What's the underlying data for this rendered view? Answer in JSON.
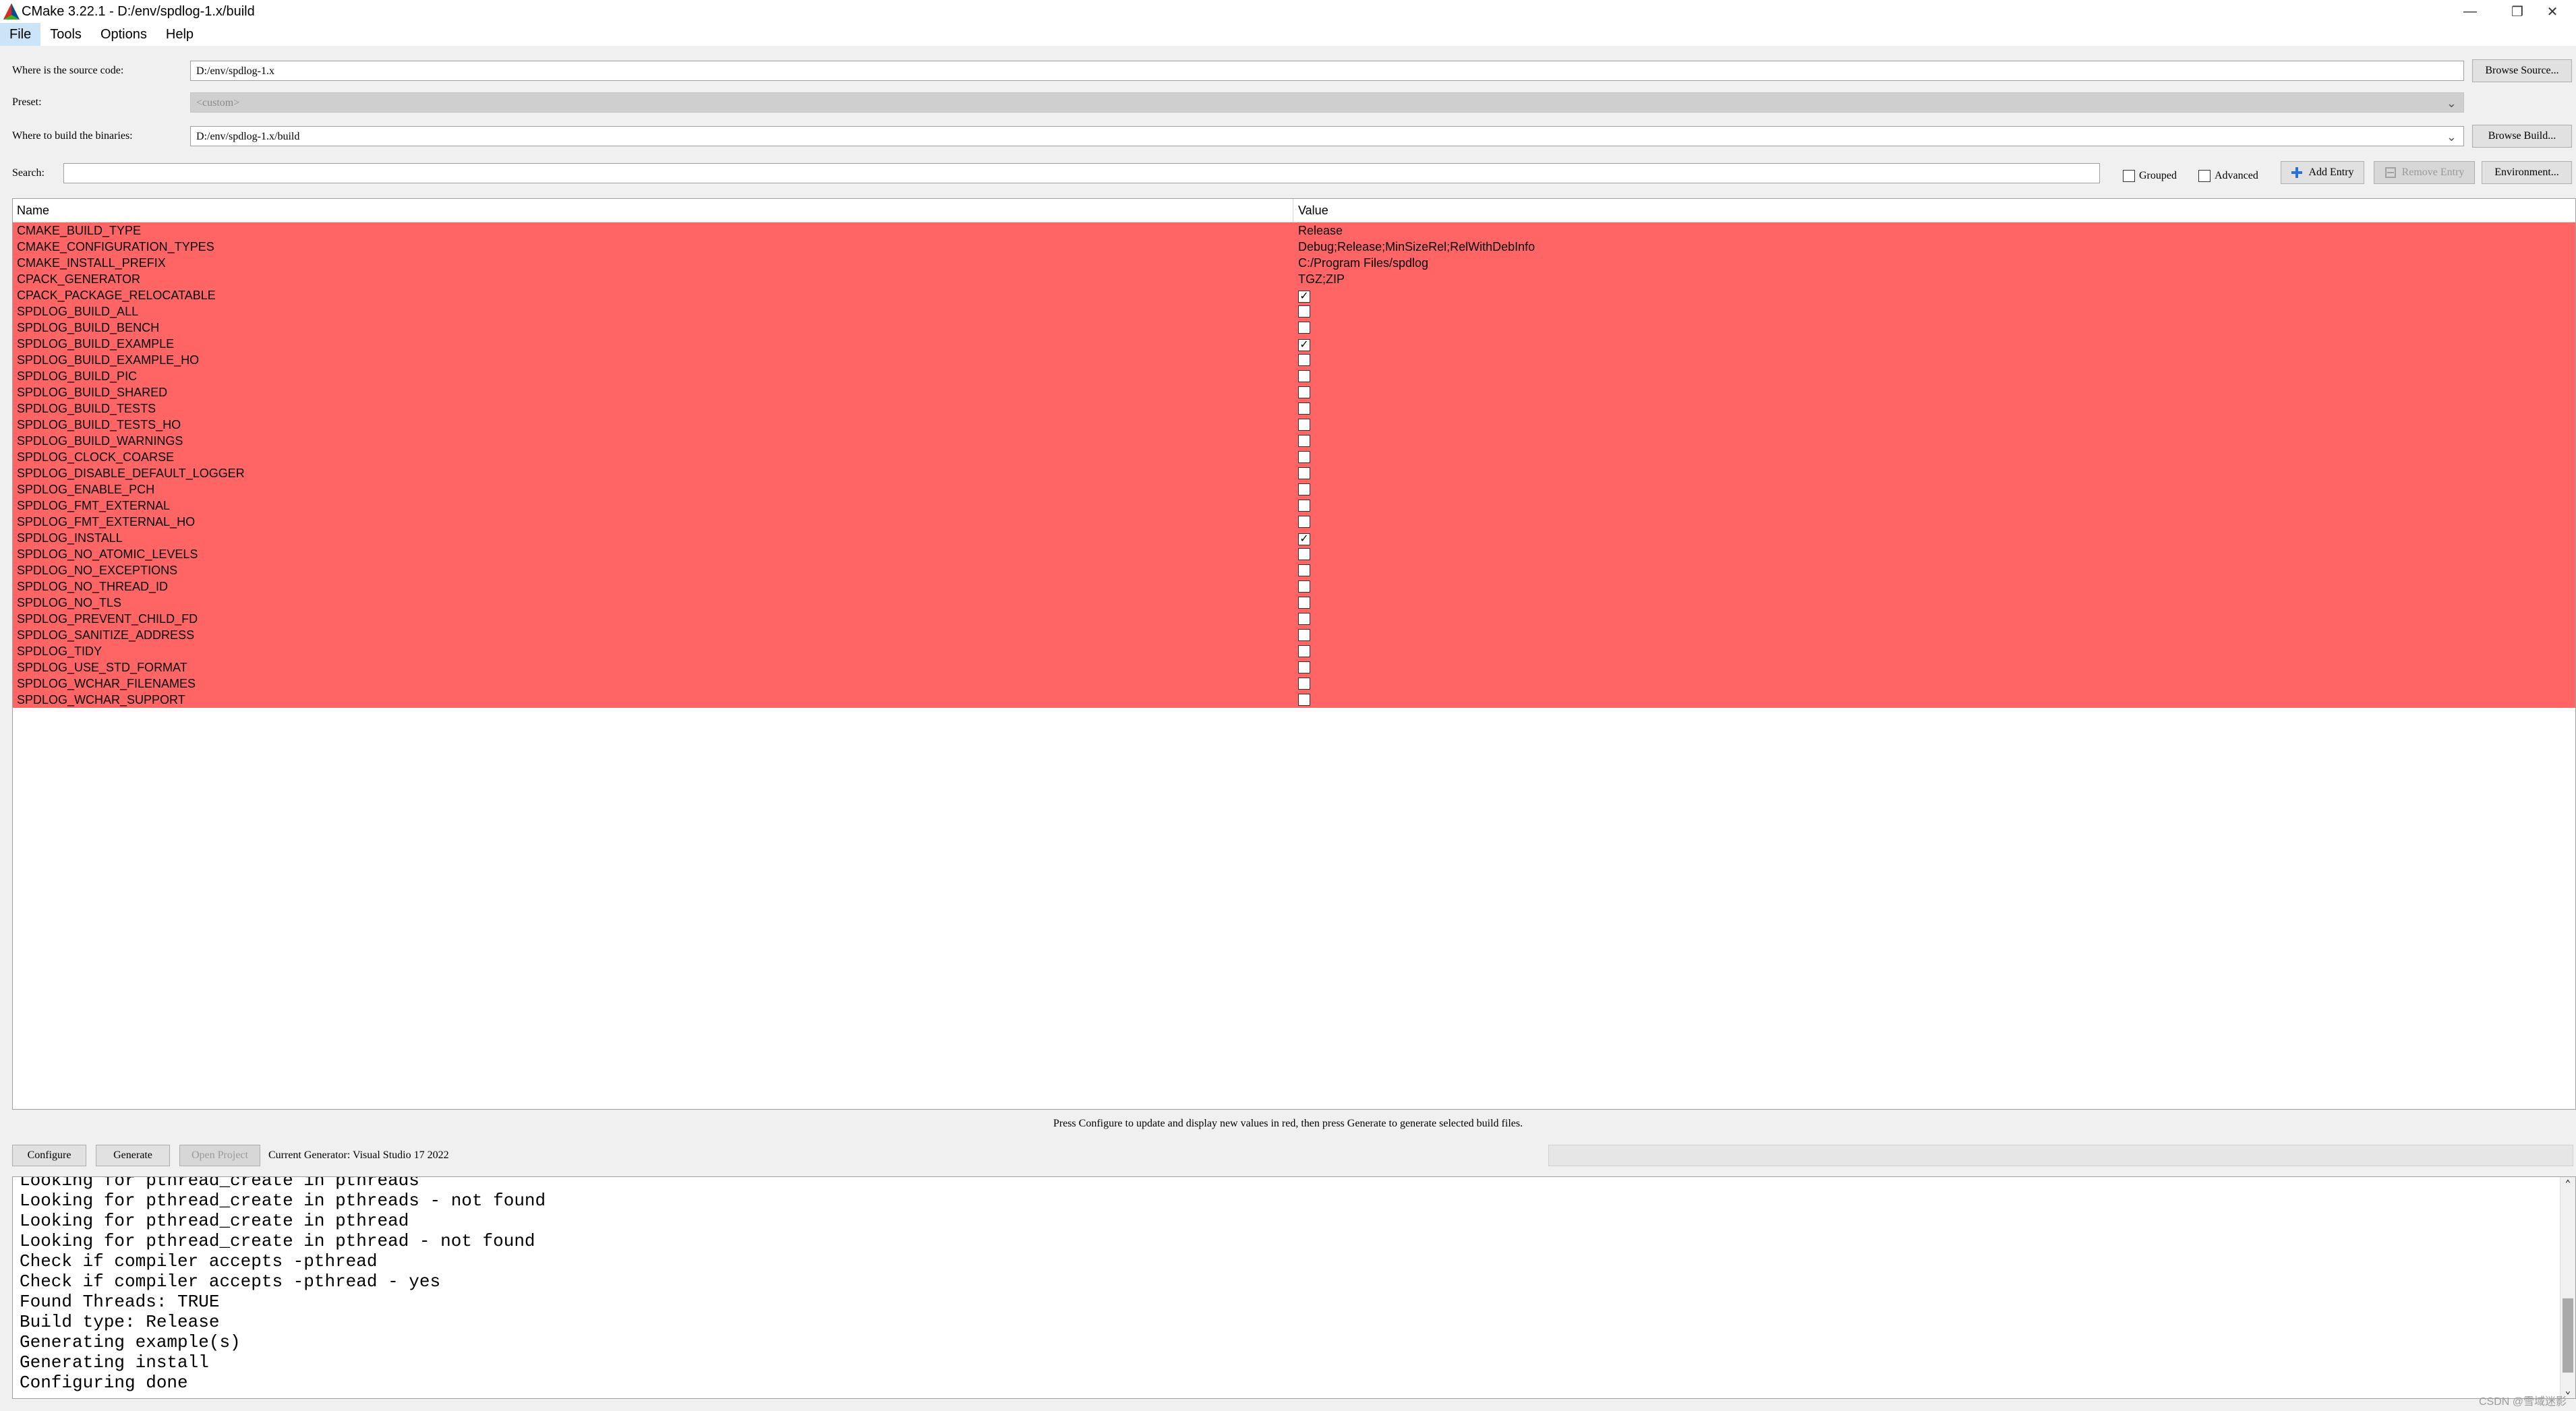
{
  "window": {
    "title": "CMake 3.22.1 - D:/env/spdlog-1.x/build",
    "minimize": "—",
    "restore": "❐",
    "close": "✕"
  },
  "menu": [
    "File",
    "Tools",
    "Options",
    "Help"
  ],
  "form": {
    "source_label": "Where is the source code:",
    "source_value": "D:/env/spdlog-1.x",
    "browse_source": "Browse Source...",
    "preset_label": "Preset:",
    "preset_value": "<custom>",
    "build_label": "Where to build the binaries:",
    "build_value": "D:/env/spdlog-1.x/build",
    "browse_build": "Browse Build...",
    "search_label": "Search:",
    "search_value": "",
    "grouped_label": "Grouped",
    "advanced_label": "Advanced",
    "add_entry": "Add Entry",
    "remove_entry": "Remove Entry",
    "environment": "Environment..."
  },
  "table": {
    "headers": {
      "name": "Name",
      "value": "Value"
    },
    "row_color": "#ff6565",
    "rows": [
      {
        "name": "CMAKE_BUILD_TYPE",
        "type": "text",
        "value": "Release"
      },
      {
        "name": "CMAKE_CONFIGURATION_TYPES",
        "type": "text",
        "value": "Debug;Release;MinSizeRel;RelWithDebInfo"
      },
      {
        "name": "CMAKE_INSTALL_PREFIX",
        "type": "text",
        "value": "C:/Program Files/spdlog"
      },
      {
        "name": "CPACK_GENERATOR",
        "type": "text",
        "value": "TGZ;ZIP"
      },
      {
        "name": "CPACK_PACKAGE_RELOCATABLE",
        "type": "bool",
        "checked": true
      },
      {
        "name": "SPDLOG_BUILD_ALL",
        "type": "bool",
        "checked": false
      },
      {
        "name": "SPDLOG_BUILD_BENCH",
        "type": "bool",
        "checked": false
      },
      {
        "name": "SPDLOG_BUILD_EXAMPLE",
        "type": "bool",
        "checked": true
      },
      {
        "name": "SPDLOG_BUILD_EXAMPLE_HO",
        "type": "bool",
        "checked": false
      },
      {
        "name": "SPDLOG_BUILD_PIC",
        "type": "bool",
        "checked": false
      },
      {
        "name": "SPDLOG_BUILD_SHARED",
        "type": "bool",
        "checked": false
      },
      {
        "name": "SPDLOG_BUILD_TESTS",
        "type": "bool",
        "checked": false
      },
      {
        "name": "SPDLOG_BUILD_TESTS_HO",
        "type": "bool",
        "checked": false
      },
      {
        "name": "SPDLOG_BUILD_WARNINGS",
        "type": "bool",
        "checked": false
      },
      {
        "name": "SPDLOG_CLOCK_COARSE",
        "type": "bool",
        "checked": false
      },
      {
        "name": "SPDLOG_DISABLE_DEFAULT_LOGGER",
        "type": "bool",
        "checked": false
      },
      {
        "name": "SPDLOG_ENABLE_PCH",
        "type": "bool",
        "checked": false
      },
      {
        "name": "SPDLOG_FMT_EXTERNAL",
        "type": "bool",
        "checked": false
      },
      {
        "name": "SPDLOG_FMT_EXTERNAL_HO",
        "type": "bool",
        "checked": false
      },
      {
        "name": "SPDLOG_INSTALL",
        "type": "bool",
        "checked": true
      },
      {
        "name": "SPDLOG_NO_ATOMIC_LEVELS",
        "type": "bool",
        "checked": false
      },
      {
        "name": "SPDLOG_NO_EXCEPTIONS",
        "type": "bool",
        "checked": false
      },
      {
        "name": "SPDLOG_NO_THREAD_ID",
        "type": "bool",
        "checked": false
      },
      {
        "name": "SPDLOG_NO_TLS",
        "type": "bool",
        "checked": false
      },
      {
        "name": "SPDLOG_PREVENT_CHILD_FD",
        "type": "bool",
        "checked": false
      },
      {
        "name": "SPDLOG_SANITIZE_ADDRESS",
        "type": "bool",
        "checked": false
      },
      {
        "name": "SPDLOG_TIDY",
        "type": "bool",
        "checked": false
      },
      {
        "name": "SPDLOG_USE_STD_FORMAT",
        "type": "bool",
        "checked": false
      },
      {
        "name": "SPDLOG_WCHAR_FILENAMES",
        "type": "bool",
        "checked": false
      },
      {
        "name": "SPDLOG_WCHAR_SUPPORT",
        "type": "bool",
        "checked": false
      }
    ]
  },
  "hint": "Press Configure to update and display new values in red, then press Generate to generate selected build files.",
  "actions": {
    "configure": "Configure",
    "generate": "Generate",
    "open_project": "Open Project",
    "generator": "Current Generator: Visual Studio 17 2022"
  },
  "log": [
    "Looking for pthread_create in pthreads",
    "Looking for pthread_create in pthreads - not found",
    "Looking for pthread_create in pthread",
    "Looking for pthread_create in pthread - not found",
    "Check if compiler accepts -pthread",
    "Check if compiler accepts -pthread - yes",
    "Found Threads: TRUE",
    "Build type: Release",
    "Generating example(s)",
    "Generating install",
    "Configuring done"
  ],
  "watermark": "CSDN @雪域迷影"
}
